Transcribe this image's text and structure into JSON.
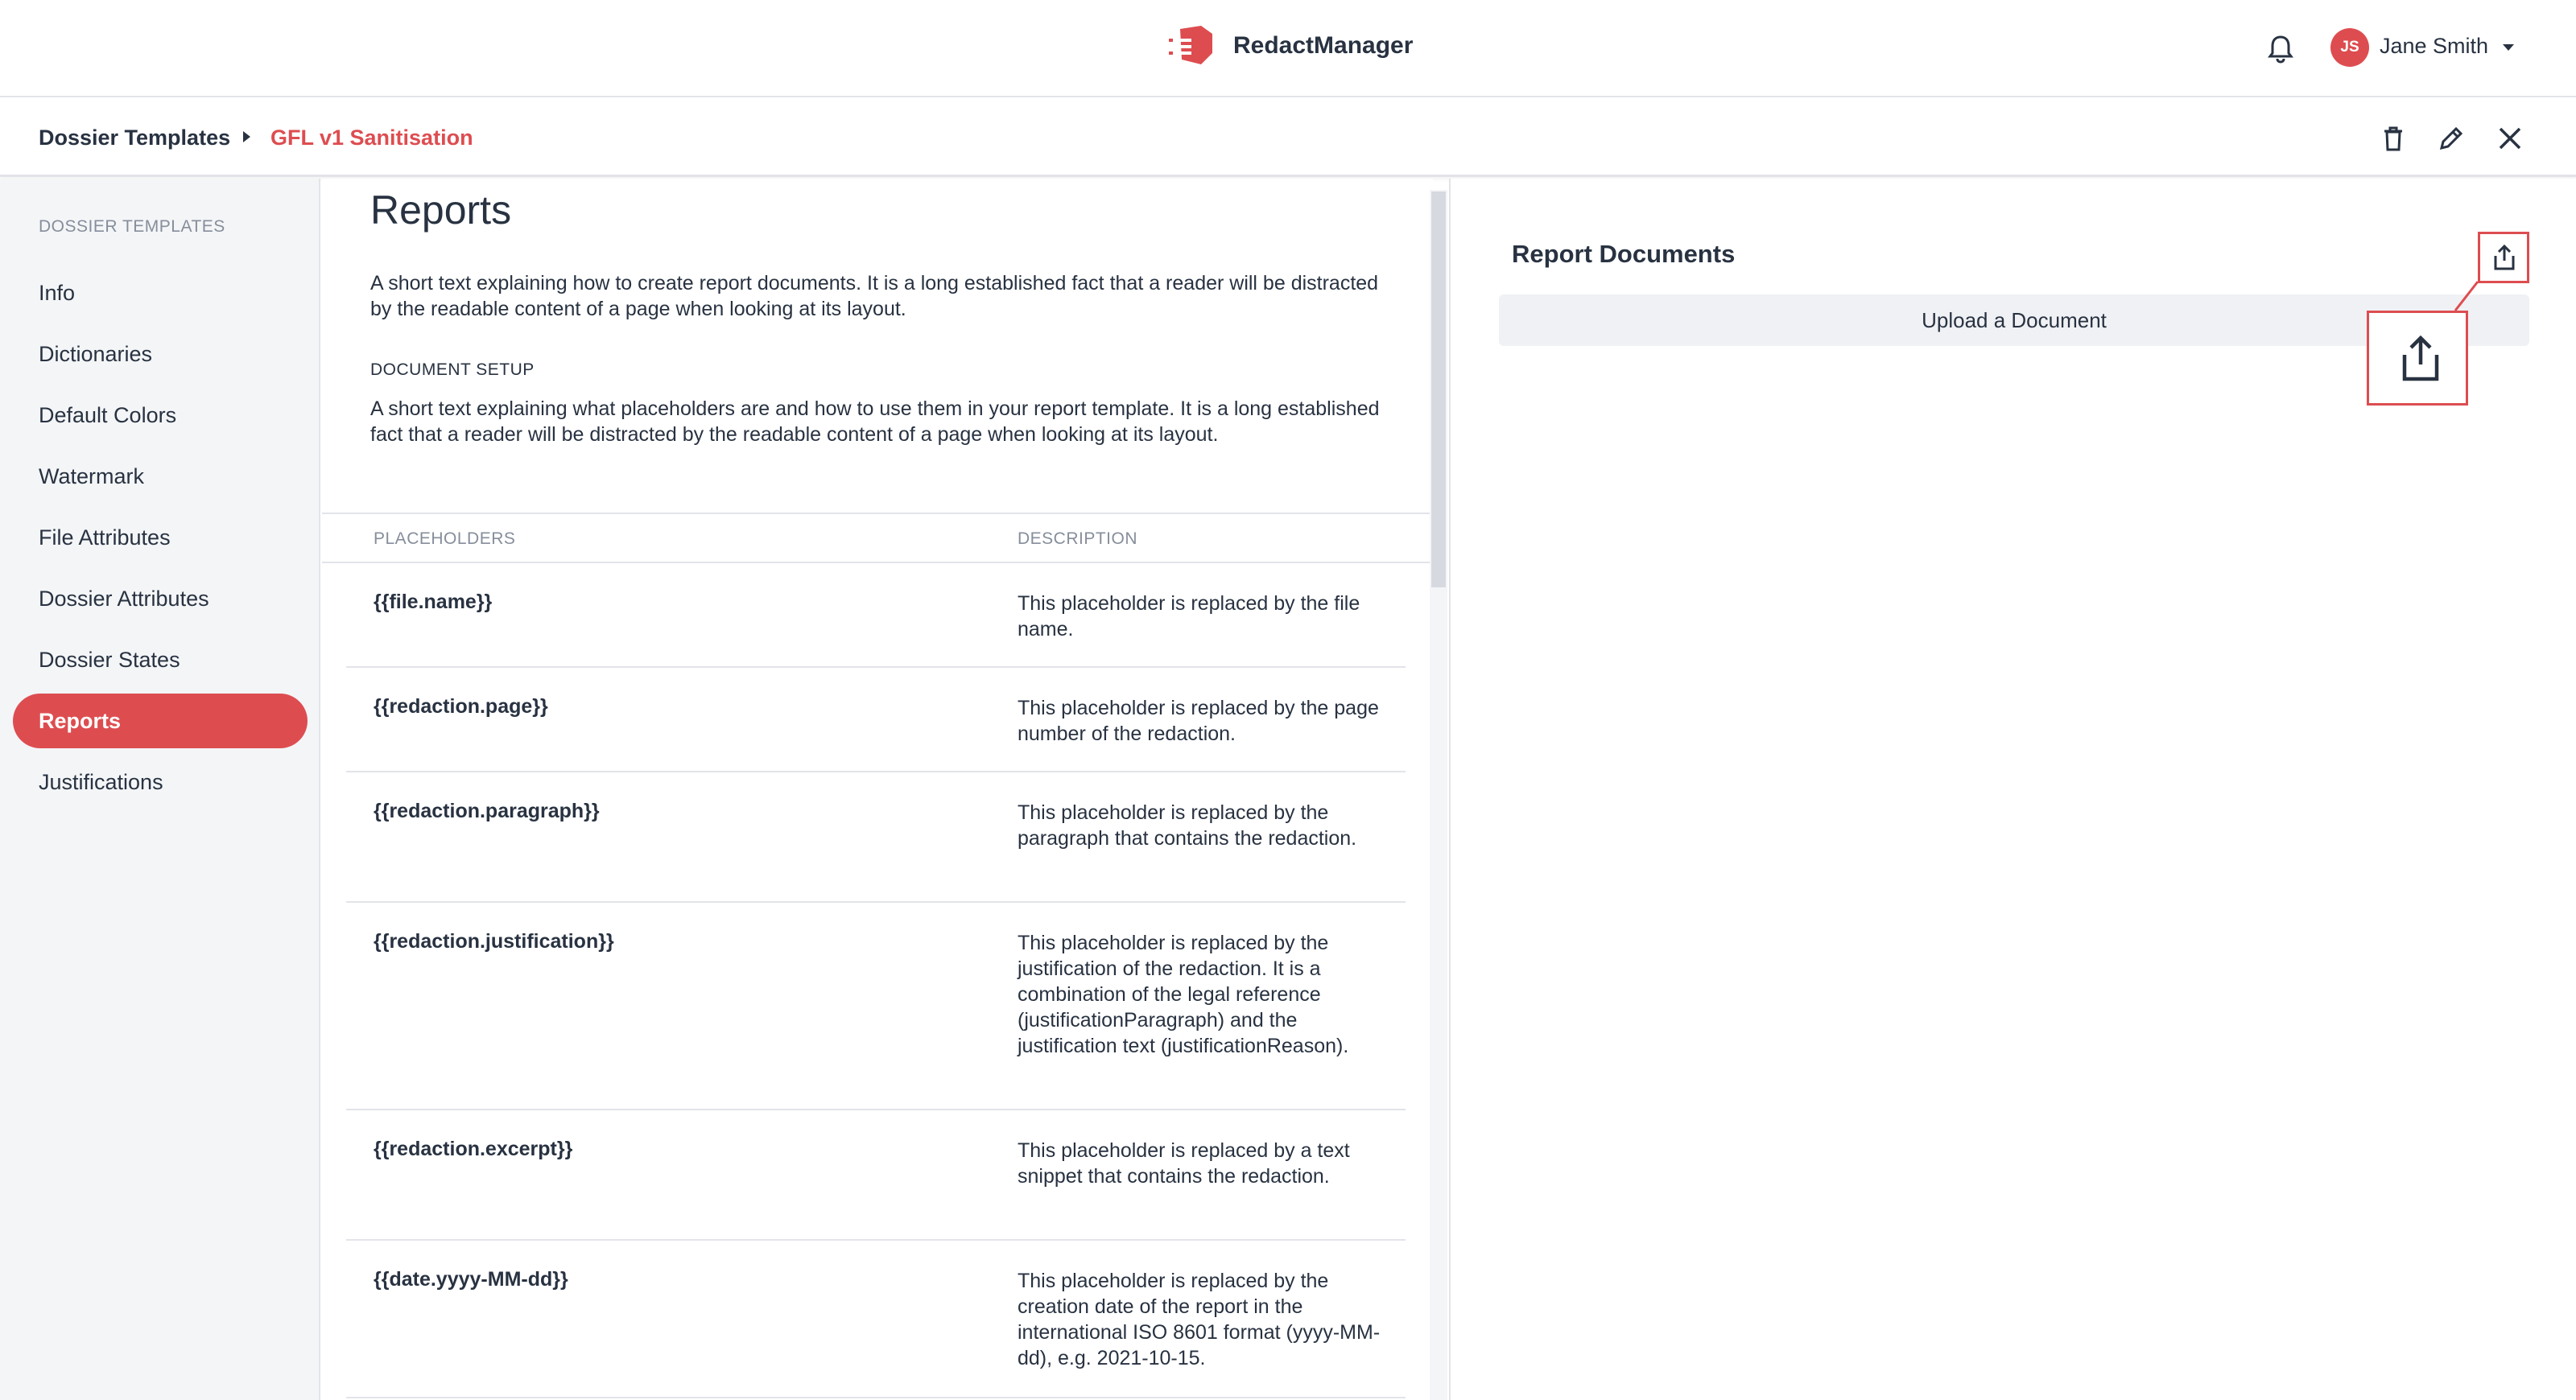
{
  "header": {
    "app_name": "RedactManager",
    "user": {
      "initials": "JS",
      "name": "Jane Smith"
    },
    "icons": {
      "logo": "redact-logo-icon",
      "notifications": "bell-icon",
      "user_menu": "caret-down-icon"
    },
    "colors": {
      "brand": "#dd4d50",
      "text": "#283241"
    }
  },
  "breadcrumb": {
    "items": [
      "Dossier Templates",
      "GFL v1 Sanitisation"
    ],
    "actions": [
      "trash-icon",
      "pencil-icon",
      "close-icon"
    ]
  },
  "sidebar": {
    "title": "DOSSIER TEMPLATES",
    "items": [
      {
        "label": "Info"
      },
      {
        "label": "Dictionaries"
      },
      {
        "label": "Default Colors"
      },
      {
        "label": "Watermark"
      },
      {
        "label": "File Attributes"
      },
      {
        "label": "Dossier Attributes"
      },
      {
        "label": "Dossier States"
      },
      {
        "label": "Reports",
        "active": true
      },
      {
        "label": "Justifications"
      }
    ]
  },
  "main": {
    "title": "Reports",
    "intro": "A short text explaining how to create report documents. It is a long established fact that a reader will be distracted by the readable content of a page when looking at its layout.",
    "setup_label": "DOCUMENT SETUP",
    "setup_text": "A short text explaining what placeholders are and how to use them in your report template. It is a long established fact that a reader will be distracted by the readable content of a page when looking at its layout.",
    "table": {
      "headers": [
        "PLACEHOLDERS",
        "DESCRIPTION"
      ],
      "rows": [
        {
          "placeholder": "{{file.name}}",
          "description": "This placeholder is replaced by the file name."
        },
        {
          "placeholder": "{{redaction.page}}",
          "description": "This placeholder is replaced by the page number of the redaction."
        },
        {
          "placeholder": "{{redaction.paragraph}}",
          "description": "This placeholder is replaced by the paragraph that contains the redaction."
        },
        {
          "placeholder": "{{redaction.justification}}",
          "description": "This placeholder is replaced by the justification of the redaction. It is a combination of the legal reference (justificationParagraph) and the justification text (justificationReason)."
        },
        {
          "placeholder": "{{redaction.excerpt}}",
          "description": "This placeholder is replaced by a text snippet that contains the redaction."
        },
        {
          "placeholder": "{{date.yyyy-MM-dd}}",
          "description": "This placeholder is replaced by the creation date of the report in the international ISO 8601 format (yyyy-MM-dd), e.g. 2021-10-15."
        }
      ]
    }
  },
  "right_panel": {
    "title": "Report Documents",
    "upload_label": "Upload a Document",
    "upload_icon": "upload-icon"
  }
}
